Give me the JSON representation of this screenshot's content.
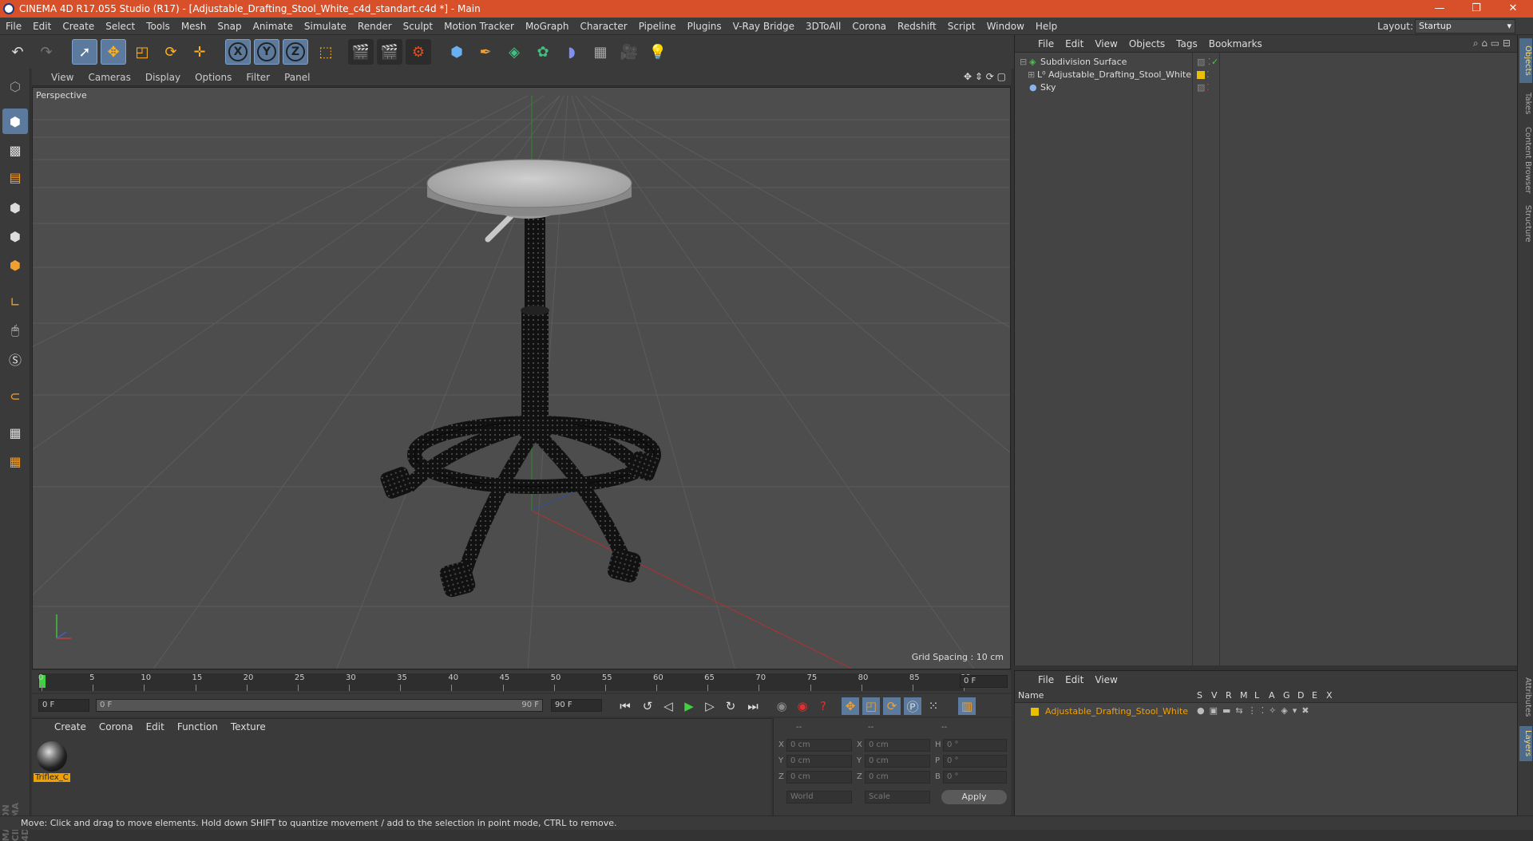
{
  "window": {
    "title": "CINEMA 4D R17.055 Studio (R17) - [Adjustable_Drafting_Stool_White_c4d_standart.c4d *] - Main"
  },
  "menubar": {
    "items": [
      "File",
      "Edit",
      "Create",
      "Select",
      "Tools",
      "Mesh",
      "Snap",
      "Animate",
      "Simulate",
      "Render",
      "Sculpt",
      "Motion Tracker",
      "MoGraph",
      "Character",
      "Pipeline",
      "Plugins",
      "V-Ray Bridge",
      "3DToAll",
      "Corona",
      "Redshift",
      "Script",
      "Window",
      "Help"
    ],
    "layout_label": "Layout:",
    "layout_value": "Startup"
  },
  "toolbar": {
    "icons": [
      "undo-icon",
      "redo-icon",
      "select-cursor-icon",
      "move-icon",
      "scale-icon",
      "rotate-icon",
      "move-axis-icon",
      "x-axis-icon",
      "y-axis-icon",
      "z-axis-icon",
      "world-coord-icon",
      "render-view-icon",
      "render-picture-viewer-icon",
      "render-settings-icon",
      "cube-icon",
      "pen-icon",
      "subdivision-icon",
      "array-icon",
      "deformer-icon",
      "floor-icon",
      "camera-icon",
      "light-icon"
    ],
    "axis_labels": [
      "X",
      "Y",
      "Z"
    ]
  },
  "viewport": {
    "menu": [
      "View",
      "Cameras",
      "Display",
      "Options",
      "Filter",
      "Panel"
    ],
    "label": "Perspective",
    "grid_spacing": "Grid Spacing : 10 cm"
  },
  "timeline": {
    "ticks": [
      "0",
      "5",
      "10",
      "15",
      "20",
      "25",
      "30",
      "35",
      "40",
      "45",
      "50",
      "55",
      "60",
      "65",
      "70",
      "75",
      "80",
      "85",
      "90"
    ],
    "current_frame": "0 F",
    "start_frame": "0 F",
    "range_start": "0 F",
    "range_end": "90 F",
    "end_frame": "90 F"
  },
  "material_manager": {
    "menu": [
      "Create",
      "Corona",
      "Edit",
      "Function",
      "Texture"
    ],
    "materials": [
      {
        "name": "Triflex_C"
      }
    ]
  },
  "coordinates": {
    "header": [
      "--",
      "--",
      "--"
    ],
    "rows": [
      {
        "axis": "X",
        "pos": "0 cm",
        "axis2": "X",
        "size": "0 cm",
        "rot_label": "H",
        "rot": "0 °"
      },
      {
        "axis": "Y",
        "pos": "0 cm",
        "axis2": "Y",
        "size": "0 cm",
        "rot_label": "P",
        "rot": "0 °"
      },
      {
        "axis": "Z",
        "pos": "0 cm",
        "axis2": "Z",
        "size": "0 cm",
        "rot_label": "B",
        "rot": "0 °"
      }
    ],
    "mode1": "World",
    "mode2": "Scale",
    "apply": "Apply"
  },
  "object_manager": {
    "menu": [
      "File",
      "Edit",
      "View",
      "Objects",
      "Tags",
      "Bookmarks"
    ],
    "objects": [
      {
        "name": "Subdivision Surface",
        "color": "#4fbf4f"
      },
      {
        "name": "Adjustable_Drafting_Stool_White",
        "color": "#ddd"
      },
      {
        "name": "Sky",
        "color": "#8ab4e8"
      }
    ]
  },
  "layer_manager": {
    "menu": [
      "File",
      "Edit",
      "View"
    ],
    "columns": [
      "Name",
      "S",
      "V",
      "R",
      "M",
      "L",
      "A",
      "G",
      "D",
      "E",
      "X"
    ],
    "layers": [
      {
        "name": "Adjustable_Drafting_Stool_White",
        "color": "#e8c000"
      }
    ]
  },
  "side_tabs": [
    "Objects",
    "Takes",
    "Content Browser",
    "Structure",
    "Attributes",
    "Layers"
  ],
  "status": "Move: Click and drag to move elements. Hold down SHIFT to quantize movement / add to the selection in point mode, CTRL to remove.",
  "brand": {
    "maxon": "MAXON",
    "product": "CINEMA 4D"
  },
  "colors": {
    "title_bar": "#d8502a",
    "selection": "#5b7a9d",
    "accent": "#f0a000"
  }
}
